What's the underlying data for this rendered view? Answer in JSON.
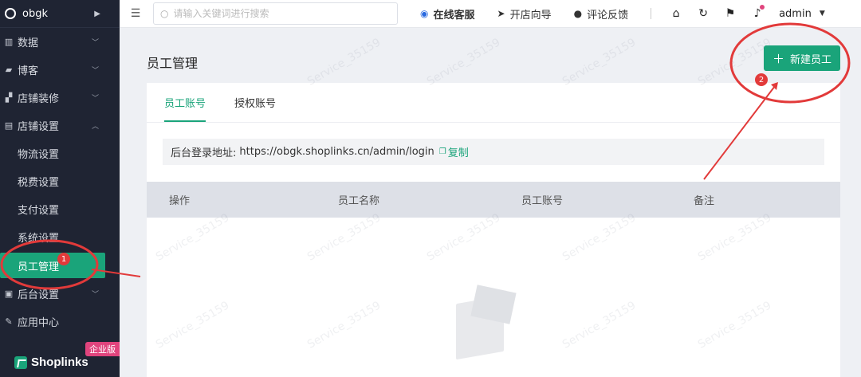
{
  "sidebar": {
    "store_name": "obgk",
    "items": [
      {
        "label": "数据"
      },
      {
        "label": "博客"
      },
      {
        "label": "店铺装修"
      },
      {
        "label": "店铺设置"
      }
    ],
    "sub_items": [
      {
        "label": "物流设置"
      },
      {
        "label": "税费设置"
      },
      {
        "label": "支付设置"
      },
      {
        "label": "系统设置"
      },
      {
        "label": "员工管理"
      }
    ],
    "items_after": [
      {
        "label": "后台设置"
      },
      {
        "label": "应用中心"
      }
    ],
    "brand": "Shoplinks",
    "edition": "企业版"
  },
  "topbar": {
    "search_placeholder": "请输入关键词进行搜索",
    "online_service": "在线客服",
    "shop_guide": "开店向导",
    "feedback": "评论反馈",
    "user": "admin"
  },
  "main": {
    "title": "员工管理",
    "new_button": "新建员工",
    "tabs": [
      {
        "label": "员工账号"
      },
      {
        "label": "授权账号"
      }
    ],
    "login_label": "后台登录地址:",
    "login_url": "https://obgk.shoplinks.cn/admin/login",
    "copy": "复制",
    "columns": [
      "操作",
      "员工名称",
      "员工账号",
      "备注"
    ]
  },
  "annotations": {
    "step1": "1",
    "step2": "2",
    "color": "#e23a3a"
  },
  "watermark": "Service_35159",
  "colors": {
    "accent": "#1aa47a",
    "sidebar_bg": "#1f2433",
    "edition_badge": "#e0447d"
  }
}
